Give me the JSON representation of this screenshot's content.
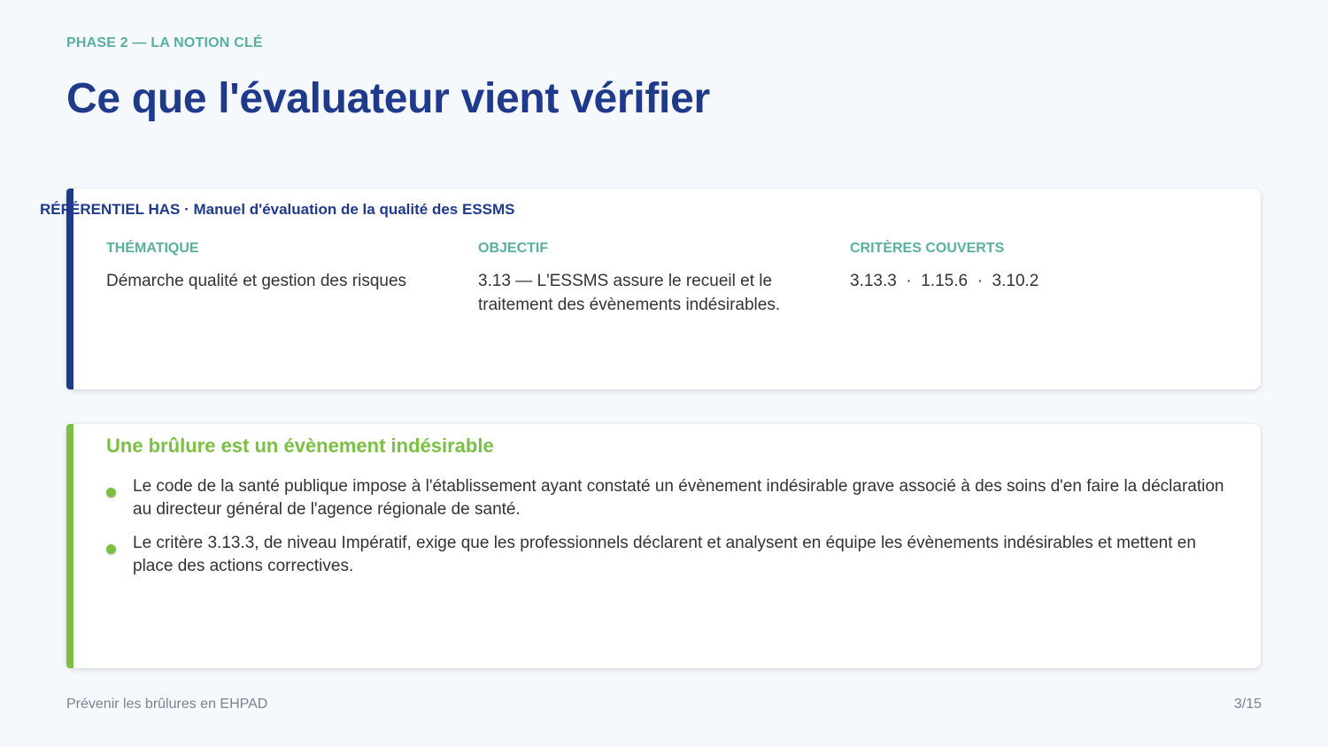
{
  "header": {
    "eyebrow": "PHASE 2 — LA NOTION CLÉ",
    "title": "Ce que l'évaluateur vient vérifier"
  },
  "referentiel": {
    "heading": "RÉFÉRENTIEL HAS · Manuel d'évaluation de la qualité des ESSMS",
    "columns": [
      {
        "label": "THÉMATIQUE",
        "value": "Démarche qualité et gestion des risques"
      },
      {
        "label": "OBJECTIF",
        "value": "3.13 — L'ESSMS assure le recueil et le traitement des évènements indésirables."
      },
      {
        "label": "CRITÈRES COUVERTS",
        "value": "3.13.3  ·  1.15.6  ·  3.10.2"
      }
    ],
    "accent_color": "#1f3a8a"
  },
  "event": {
    "title": "Une brûlure est un évènement indésirable",
    "bullets": [
      "Le code de la santé publique impose à l'établissement ayant constaté un évènement indésirable grave associé à des soins d'en faire la déclaration au directeur général de l'agence régionale de santé.",
      "Le critère 3.13.3, de niveau Impératif, exige que les professionnels déclarent et analysent en équipe les évènements indésirables et mettent en place des actions correctives."
    ],
    "accent_color": "#7ac043"
  },
  "footer": {
    "course_title": "Prévenir les brûlures en EHPAD",
    "page_indicator": "3/15"
  }
}
